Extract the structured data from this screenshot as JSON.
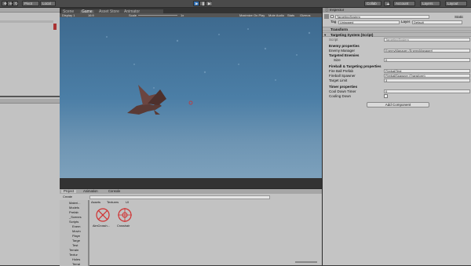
{
  "toolbar": {
    "pivot": "Pivot",
    "local": "Local",
    "collab": "Collab",
    "account": "Account",
    "layers": "Layers",
    "layout": "Layout"
  },
  "scene": {
    "tabs": [
      "Scene",
      "Game",
      "Asset Store",
      "Animator"
    ],
    "display": "Display 1",
    "aspect": "16:9",
    "scale_label": "Scale",
    "scale_value": "1x",
    "options": [
      "Maximize On Play",
      "Mute Audio",
      "Stats",
      "Gizmos"
    ]
  },
  "inspector": {
    "tab": "Inspector",
    "object_name": "TargetingSystem",
    "static_label": "Static",
    "tag_label": "Tag",
    "tag_value": "Untagged",
    "layer_label": "Layer",
    "layer_value": "Default",
    "transform_title": "Transform",
    "component_title": "Targeting System (Script)",
    "script_label": "Script",
    "script_value": "TargetingSystem",
    "enemy_section": "Enemy properties",
    "enemy_manager_label": "Enemy Manager",
    "enemy_manager_value": "EnemyManager (EnemyManager)",
    "targeted_enemies_label": "Targeted Enemies",
    "size_label": "Size",
    "size_value": "0",
    "fireball_section": "Fireball & Targeting properties",
    "fireball_prefab_label": "Fire Ball Prefab",
    "fireball_prefab_value": "FireballTest",
    "fireball_spawner_label": "Fireball Spawner",
    "fireball_spawner_value": "FireballSpawner (Transform)",
    "target_limit_label": "Target Limit",
    "target_limit_value": "3",
    "timer_section": "Timer properties",
    "cooldown_timer_label": "Cool Down Timer",
    "cooldown_timer_value": "0",
    "cooling_down_label": "Cooling Down",
    "add_component": "Add Component"
  },
  "project": {
    "tabs": [
      "Project",
      "Animation",
      "Console"
    ],
    "create_label": "Create",
    "breadcrumb": [
      "Assets",
      "Textures",
      "UI"
    ],
    "tree": [
      "Materi...",
      "Models",
      "Prefab",
      "_Scenes",
      "Scripts",
      "Enem",
      "Movin",
      "Playe",
      "Targe",
      "Test",
      "Terrain",
      "Textur",
      "Holes",
      "Terrai"
    ],
    "assets": [
      {
        "name": "AimCrossh...",
        "icon": "crosshair-icon"
      },
      {
        "name": "Crosshair",
        "icon": "crosshair-icon"
      }
    ]
  },
  "colors": {
    "accent": "#2f6fb5",
    "sky": "#4b7ea6",
    "dragon": "#5a3a35",
    "crosshair": "#d03030"
  }
}
